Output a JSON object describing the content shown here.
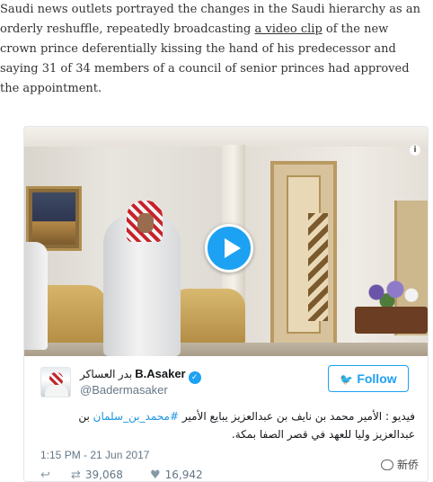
{
  "article": {
    "text_before_link": "Saudi news outlets portrayed the changes in the Saudi hierarchy as an orderly reshuffle, repeatedly broadcasting ",
    "link_text": "a video clip",
    "text_after_link": " of the new crown prince deferentially kissing the hand of his predecessor and saying 31 of 34 members of a council of senior princes had approved the appointment."
  },
  "tweet": {
    "video": {
      "info_badge": "i",
      "play_icon": "play-icon"
    },
    "author": {
      "name": "B.Asaker",
      "arabic_name": "بدر العساكر",
      "handle": "@Badermasaker",
      "verified_icon": "verified-icon"
    },
    "follow_label": "Follow",
    "follow_icon": "twitter-bird-icon",
    "text_part1": "فيديو : الأمير محمد بن نايف بن عبدالعزيز يبايع الأمير ",
    "hashtag": "#محمد_بن_سلمان",
    "text_part2": " بن عبدالعزيز وليا للعهد في قصر الصفا بمكة.",
    "timestamp": "1:15 PM - 21 Jun 2017",
    "actions": {
      "reply_icon": "reply-icon",
      "retweet_icon": "retweet-icon",
      "retweet_count": "39,068",
      "like_icon": "heart-icon",
      "like_count": "16,942"
    },
    "colors": {
      "accent": "#1da1f2",
      "text": "#14171a",
      "muted": "#657786"
    }
  },
  "watermark": {
    "label": "新侨"
  }
}
